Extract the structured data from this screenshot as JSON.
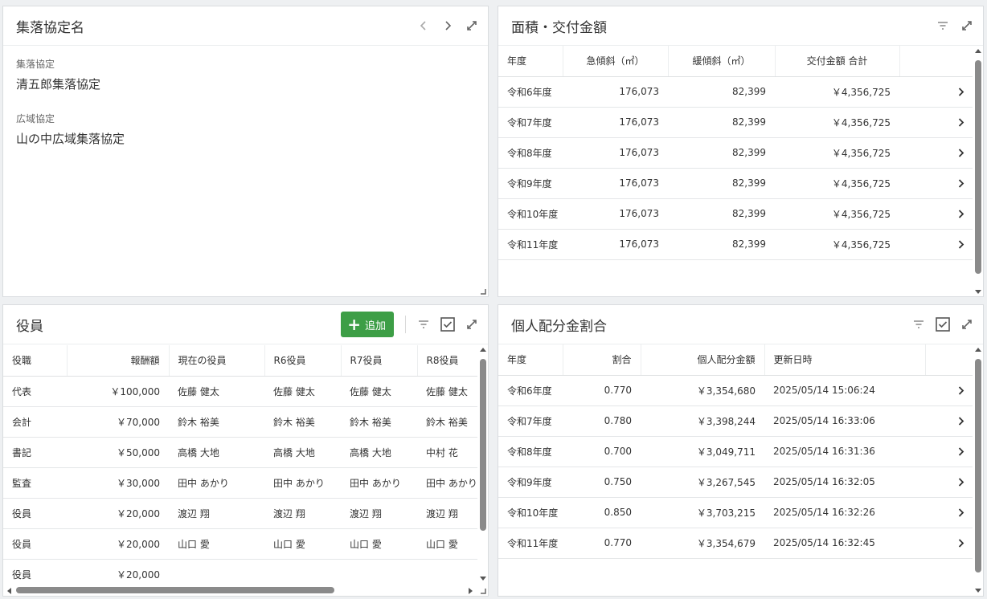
{
  "panel1": {
    "title": "集落協定名",
    "fields": [
      {
        "label": "集落協定",
        "value": "清五郎集落協定"
      },
      {
        "label": "広域協定",
        "value": "山の中広域集落協定"
      }
    ],
    "icons": [
      "chevron-left-icon",
      "chevron-right-icon",
      "expand-icon"
    ]
  },
  "panel2": {
    "title": "面積・交付金額",
    "columns": [
      "年度",
      "急傾斜（㎡）",
      "緩傾斜（㎡）",
      "交付金額 合計"
    ],
    "rows": [
      [
        "令和6年度",
        "176,073",
        "82,399",
        "￥4,356,725"
      ],
      [
        "令和7年度",
        "176,073",
        "82,399",
        "￥4,356,725"
      ],
      [
        "令和8年度",
        "176,073",
        "82,399",
        "￥4,356,725"
      ],
      [
        "令和9年度",
        "176,073",
        "82,399",
        "￥4,356,725"
      ],
      [
        "令和10年度",
        "176,073",
        "82,399",
        "￥4,356,725"
      ],
      [
        "令和11年度",
        "176,073",
        "82,399",
        "￥4,356,725"
      ]
    ]
  },
  "panel3": {
    "title": "役員",
    "add_label": "追加",
    "columns": [
      "役職",
      "報酬額",
      "現在の役員",
      "R6役員",
      "R7役員",
      "R8役員"
    ],
    "rows": [
      [
        "代表",
        "￥100,000",
        "佐藤 健太",
        "佐藤 健太",
        "佐藤 健太",
        "佐藤 健太"
      ],
      [
        "会計",
        "￥70,000",
        "鈴木 裕美",
        "鈴木 裕美",
        "鈴木 裕美",
        "鈴木 裕美"
      ],
      [
        "書記",
        "￥50,000",
        "高橋 大地",
        "高橋 大地",
        "高橋 大地",
        "中村 花"
      ],
      [
        "監査",
        "￥30,000",
        "田中 あかり",
        "田中 あかり",
        "田中 あかり",
        "田中 あかり"
      ],
      [
        "役員",
        "￥20,000",
        "渡辺 翔",
        "渡辺 翔",
        "渡辺 翔",
        "渡辺 翔"
      ],
      [
        "役員",
        "￥20,000",
        "山口 愛",
        "山口 愛",
        "山口 愛",
        "山口 愛"
      ],
      [
        "役員",
        "￥20,000",
        "",
        "",
        "",
        ""
      ]
    ]
  },
  "panel4": {
    "title": "個人配分金割合",
    "columns": [
      "年度",
      "割合",
      "個人配分金額",
      "更新日時"
    ],
    "rows": [
      [
        "令和6年度",
        "0.770",
        "￥3,354,680",
        "2025/05/14 15:06:24"
      ],
      [
        "令和7年度",
        "0.780",
        "￥3,398,244",
        "2025/05/14 16:33:06"
      ],
      [
        "令和8年度",
        "0.700",
        "￥3,049,711",
        "2025/05/14 16:31:36"
      ],
      [
        "令和9年度",
        "0.750",
        "￥3,267,545",
        "2025/05/14 16:32:05"
      ],
      [
        "令和10年度",
        "0.850",
        "￥3,703,215",
        "2025/05/14 16:32:26"
      ],
      [
        "令和11年度",
        "0.770",
        "￥3,354,679",
        "2025/05/14 16:32:45"
      ]
    ]
  },
  "colors": {
    "accent_green": "#3d9e46",
    "scrollbar": "#8a8a8a"
  }
}
